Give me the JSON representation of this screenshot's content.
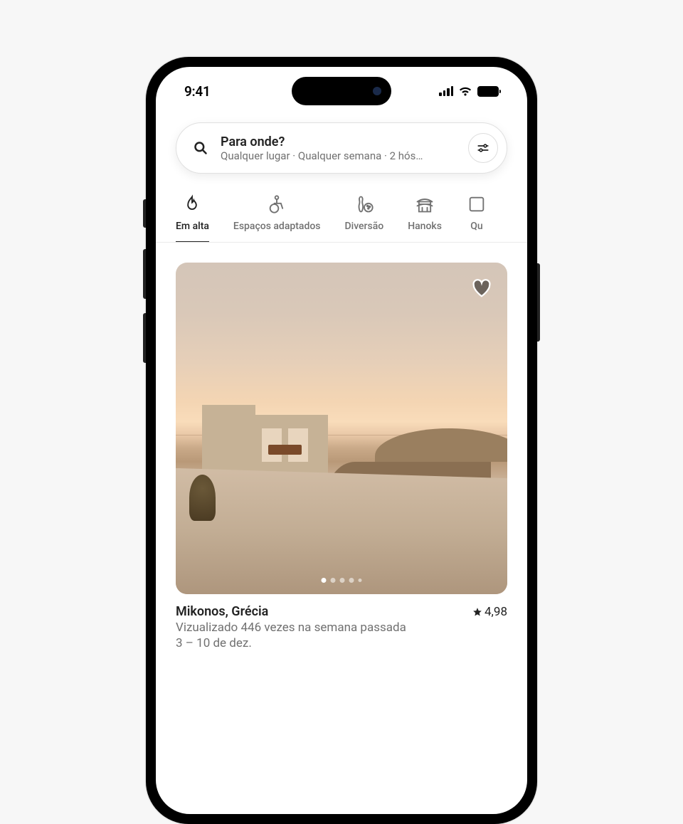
{
  "status": {
    "time": "9:41"
  },
  "search": {
    "title": "Para onde?",
    "subtitle": "Qualquer lugar · Qualquer semana · 2 hósp..."
  },
  "categories": [
    {
      "label": "Em alta",
      "icon": "flame",
      "active": true
    },
    {
      "label": "Espaços adaptados",
      "icon": "wheelchair",
      "active": false
    },
    {
      "label": "Diversão",
      "icon": "bowling",
      "active": false
    },
    {
      "label": "Hanoks",
      "icon": "hanok",
      "active": false
    },
    {
      "label": "Qu",
      "icon": "more",
      "active": false
    }
  ],
  "listing": {
    "title": "Mikonos, Grécia",
    "rating": "4,98",
    "line1": "Vizualizado 446 vezes na semana passada",
    "line2": "3 – 10 de dez."
  }
}
